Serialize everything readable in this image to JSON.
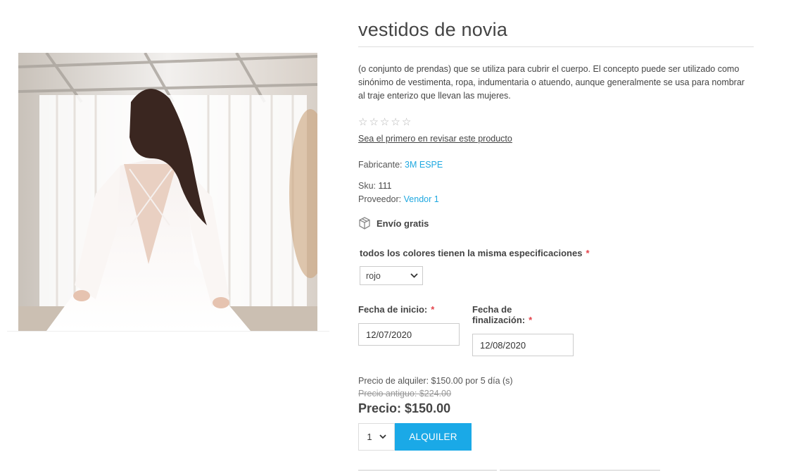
{
  "product": {
    "title": "vestidos de novia",
    "description": "(o conjunto de prendas) que se utiliza para cubrir el cuerpo. El concepto puede ser utilizado como sinónimo de vestimenta, ropa, indumentaria o atuendo, aunque generalmente se usa para nombrar al traje enterizo que llevan las mujeres.",
    "image": "wedding-dress-photo",
    "rating": {
      "stars": 0,
      "max_stars": 5,
      "review_link": "Sea el primero en revisar este producto"
    },
    "manufacturer": {
      "label": "Fabricante:",
      "value": "3M ESPE"
    },
    "sku": {
      "label": "Sku:",
      "value": "111"
    },
    "vendor": {
      "label": "Proveedor:",
      "value": "Vendor 1"
    },
    "shipping": {
      "icon": "package-icon",
      "label": "Envío gratis"
    }
  },
  "attribute": {
    "label": "todos los colores tienen la misma especificaciones",
    "required_mark": "*",
    "selected": "rojo"
  },
  "rental": {
    "start_label": "Fecha de inicio:",
    "start_value": "12/07/2020",
    "end_label": "Fecha de finalización:",
    "end_value": "12/08/2020",
    "required_mark": "*",
    "rental_price_text": "Precio de alquiler: $150.00 por 5 día (s)",
    "old_price_text": "Precio antiguo: $224.00",
    "price_text": "Precio: $150.00"
  },
  "cart": {
    "quantity": "1",
    "button_label": "ALQUILER"
  },
  "colors": {
    "accent": "#1aa9e7",
    "link": "#1fa8e0",
    "required": "#e4434b"
  }
}
